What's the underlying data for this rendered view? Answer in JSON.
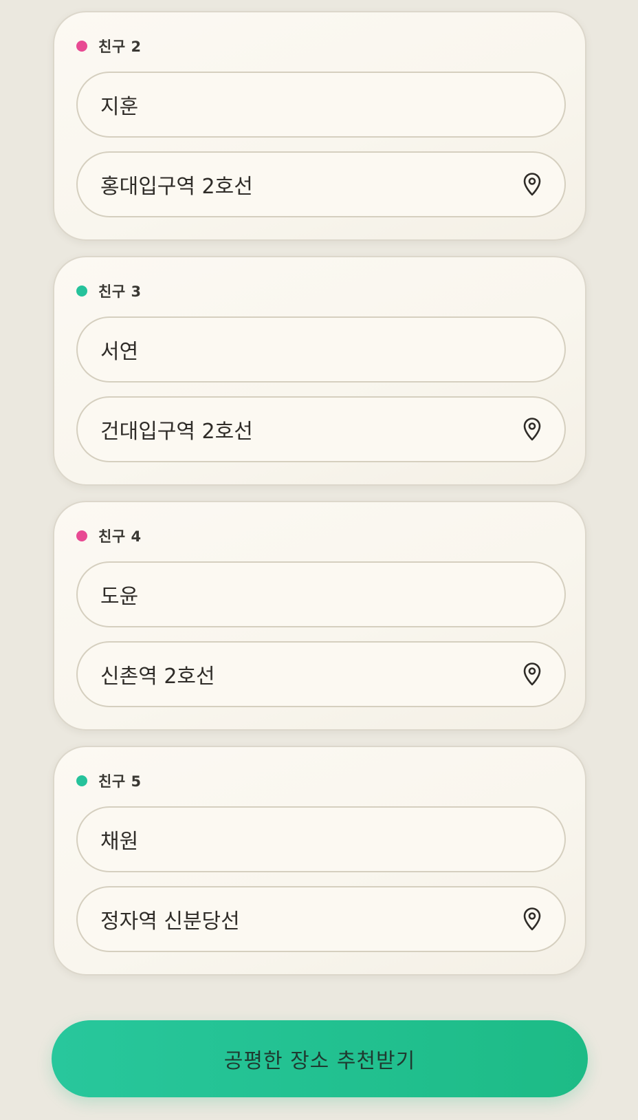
{
  "friends": [
    {
      "label": "친구 2",
      "dot_color": "#e84a93",
      "name": "지훈",
      "station": "홍대입구역 2호선",
      "station_icon": "location-pin-icon"
    },
    {
      "label": "친구 3",
      "dot_color": "#26c29b",
      "name": "서연",
      "station": "건대입구역 2호선",
      "station_icon": "location-pin-icon"
    },
    {
      "label": "친구 4",
      "dot_color": "#e84a93",
      "name": "도윤",
      "station": "신촌역 2호선",
      "station_icon": "location-pin-icon"
    },
    {
      "label": "친구 5",
      "dot_color": "#26c29b",
      "name": "채원",
      "station": "정자역 신분당선",
      "station_icon": "location-pin-icon"
    }
  ],
  "cta": {
    "label": "공평한 장소 추천받기",
    "color": "#22c290"
  }
}
